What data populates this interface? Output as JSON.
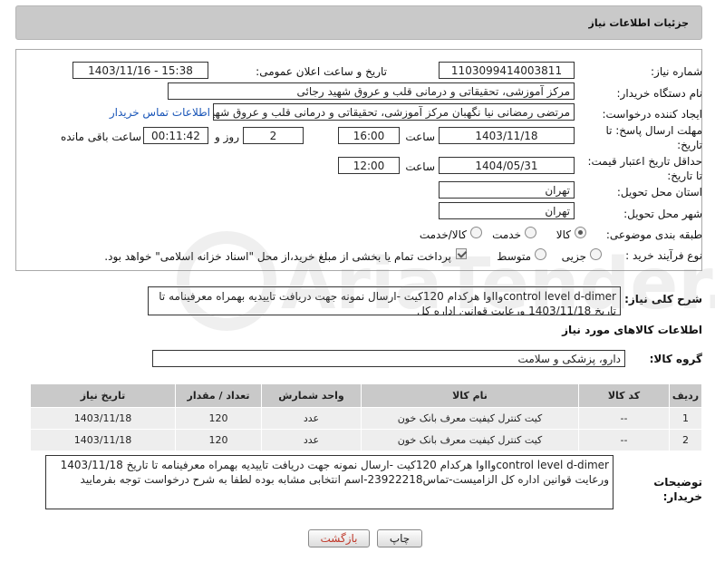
{
  "header": {
    "title": "جزئیات اطلاعات نیاز"
  },
  "form": {
    "need_number": {
      "label": "شماره نیاز:",
      "value": "1103099414003811"
    },
    "announce_datetime": {
      "label": "تاریخ و ساعت اعلان عمومی:",
      "value": "1403/11/16 - 15:38"
    },
    "buyer_org": {
      "label": "نام دستگاه خریدار:",
      "value": "مرکز آموزشی، تحقیقاتی و درمانی قلب و عروق شهید رجائی"
    },
    "requester": {
      "label": "ایجاد کننده درخواست:",
      "value": "مرتضی رمضانی نیا نگهبان مرکز آموزشی، تحقیقاتی و درمانی قلب و عروق شهید",
      "contact_link": "اطلاعات تماس خریدار"
    },
    "send_deadline": {
      "label": "مهلت ارسال پاسخ: تا تاریخ:",
      "date": "1403/11/18",
      "time_label": "ساعت",
      "time": "16:00",
      "days": "2",
      "days_label": "روز و",
      "remaining": "00:11:42",
      "remaining_label": "ساعت باقی مانده"
    },
    "price_validity": {
      "label": "حداقل تاریخ اعتبار قیمت: تا تاریخ:",
      "date": "1404/05/31",
      "time_label": "ساعت",
      "time": "12:00"
    },
    "province": {
      "label": "استان محل تحویل:",
      "value": "تهران"
    },
    "city": {
      "label": "شهر محل تحویل:",
      "value": "تهران"
    },
    "category": {
      "label": "طبقه بندی موضوعی:",
      "options": [
        "کالا",
        "خدمت",
        "کالا/خدمت"
      ],
      "selected": "کالا"
    },
    "purchase_type": {
      "label": "نوع فرآیند خرید :",
      "options": [
        "جزیی",
        "متوسط"
      ],
      "note": "پرداخت تمام یا بخشی از مبلغ خرید،از محل \"اسناد خزانه اسلامی\" خواهد بود."
    }
  },
  "description": {
    "label": "شرح کلی نیاز:",
    "text": "control level d-dimerوIIوI هرکدام 120کیت -ارسال نمونه جهت دریافت تاییدیه بهمراه معرفینامه تا تاریخ 1403/11/18 ورعایت قوانین اداره کل"
  },
  "goods_section": {
    "title": "اطلاعات کالاهای مورد نیاز",
    "group_label": "گروه کالا:",
    "group_value": "دارو، پزشکی و سلامت"
  },
  "table": {
    "headers": [
      "ردیف",
      "کد کالا",
      "نام کالا",
      "واحد شمارش",
      "تعداد / مقدار",
      "تاریخ نیاز"
    ],
    "rows": [
      [
        "1",
        "--",
        "کیت کنترل کیفیت معرف بانک خون",
        "عدد",
        "120",
        "1403/11/18"
      ],
      [
        "2",
        "--",
        "کیت کنترل کیفیت معرف بانک خون",
        "عدد",
        "120",
        "1403/11/18"
      ]
    ]
  },
  "buyer_notes": {
    "label": "توضیحات خریدار:",
    "text": "control level d-dimerوIIوI هرکدام 120کیت -ارسال نمونه جهت دریافت تاییدیه بهمراه معرفینامه تا تاریخ 1403/11/18 ورعایت قوانین اداره کل الزامیست-تماس23922218-اسم انتخابی مشابه بوده لطفا به شرح درخواست توجه بفرمایید"
  },
  "buttons": {
    "print": "چاپ",
    "back": "بازگشت"
  },
  "watermark": {
    "text": "AriaTender.net"
  }
}
